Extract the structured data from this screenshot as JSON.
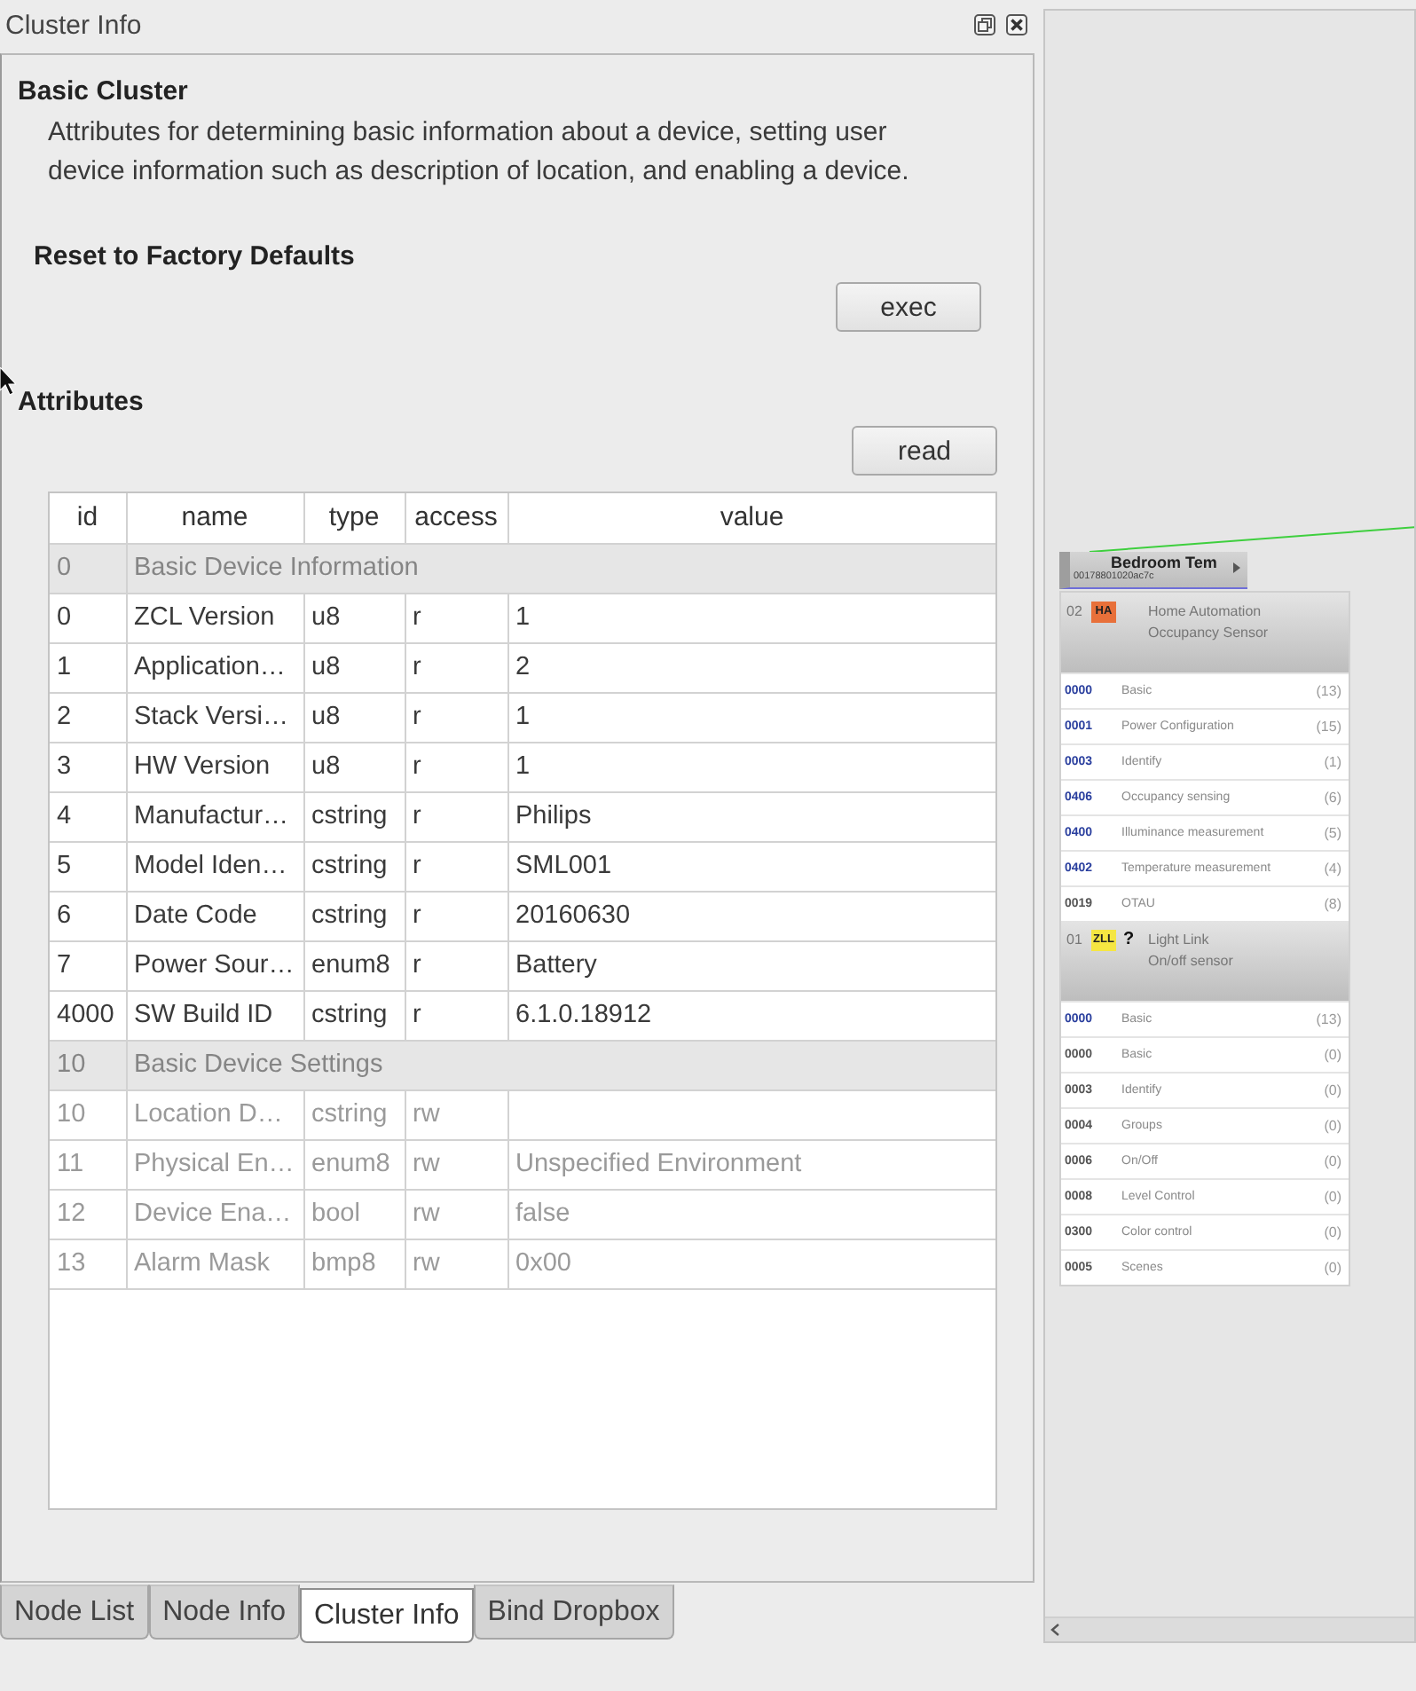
{
  "window": {
    "title": "Cluster Info"
  },
  "cluster": {
    "title": "Basic Cluster",
    "description": "Attributes for determining basic information about a device, setting user device information such as description of location, and enabling a device.",
    "commands": [
      {
        "title": "Reset to Factory Defaults",
        "button": "exec"
      }
    ],
    "attributes": {
      "title": "Attributes",
      "button": "read"
    }
  },
  "table": {
    "columns": [
      "id",
      "name",
      "type",
      "access",
      "value"
    ],
    "rows": [
      {
        "kind": "group",
        "id": "0",
        "name": "Basic Device Information"
      },
      {
        "kind": "attribute",
        "id": "0",
        "name": "ZCL Version",
        "type": "u8",
        "access": "r",
        "value": "1",
        "disabled": false
      },
      {
        "kind": "attribute",
        "id": "1",
        "name": "Application…",
        "type": "u8",
        "access": "r",
        "value": "2",
        "disabled": false
      },
      {
        "kind": "attribute",
        "id": "2",
        "name": "Stack Versi…",
        "type": "u8",
        "access": "r",
        "value": "1",
        "disabled": false
      },
      {
        "kind": "attribute",
        "id": "3",
        "name": "HW Version",
        "type": "u8",
        "access": "r",
        "value": "1",
        "disabled": false
      },
      {
        "kind": "attribute",
        "id": "4",
        "name": "Manufactur…",
        "type": "cstring",
        "access": "r",
        "value": "Philips",
        "disabled": false
      },
      {
        "kind": "attribute",
        "id": "5",
        "name": "Model Iden…",
        "type": "cstring",
        "access": "r",
        "value": "SML001",
        "disabled": false
      },
      {
        "kind": "attribute",
        "id": "6",
        "name": "Date Code",
        "type": "cstring",
        "access": "r",
        "value": "20160630",
        "disabled": false
      },
      {
        "kind": "attribute",
        "id": "7",
        "name": "Power Sour…",
        "type": "enum8",
        "access": "r",
        "value": "Battery",
        "disabled": false
      },
      {
        "kind": "attribute",
        "id": "4000",
        "name": "SW Build ID",
        "type": "cstring",
        "access": "r",
        "value": "6.1.0.18912",
        "disabled": false
      },
      {
        "kind": "group",
        "id": "10",
        "name": "Basic Device Settings"
      },
      {
        "kind": "attribute",
        "id": "10",
        "name": "Location D…",
        "type": "cstring",
        "access": "rw",
        "disabled": true
      },
      {
        "kind": "attribute",
        "id": "11",
        "name": "Physical En…",
        "type": "enum8",
        "access": "rw",
        "value": "Unspecified Environment",
        "disabled": true
      },
      {
        "kind": "attribute",
        "id": "12",
        "name": "Device Ena…",
        "type": "bool",
        "access": "rw",
        "value": "false",
        "disabled": true
      },
      {
        "kind": "attribute",
        "id": "13",
        "name": "Alarm Mask",
        "type": "bmp8",
        "access": "rw",
        "value": "0x00",
        "disabled": true
      }
    ]
  },
  "tabs": [
    {
      "label": "Node List",
      "selected": false
    },
    {
      "label": "Node Info",
      "selected": false
    },
    {
      "label": "Cluster Info",
      "selected": true
    },
    {
      "label": "Bind Dropbox",
      "selected": false
    }
  ],
  "canvas": {
    "node": {
      "title": "Bedroom Tem",
      "address": "00178801020ac7c",
      "endpoints": [
        {
          "number": "02",
          "profile": "HA",
          "color": "#e8703a",
          "profile_name": "Home Automation",
          "device_type": "Occupancy Sensor",
          "clusters": [
            {
              "id": "0000",
              "name": "Basic",
              "count": "(13)",
              "color": "#2a3f9e"
            },
            {
              "id": "0001",
              "name": "Power Configuration",
              "count": "(15)",
              "color": "#2a3f9e"
            },
            {
              "id": "0003",
              "name": "Identify",
              "count": "(1)",
              "color": "#2a3f9e"
            },
            {
              "id": "0406",
              "name": "Occupancy sensing",
              "count": "(6)",
              "color": "#2a3f9e"
            },
            {
              "id": "0400",
              "name": "Illuminance measurement",
              "count": "(5)",
              "color": "#2a3f9e"
            },
            {
              "id": "0402",
              "name": "Temperature measurement",
              "count": "(4)",
              "color": "#2a3f9e"
            },
            {
              "id": "0019",
              "name": "OTAU",
              "count": "(8)",
              "color": "#555555"
            }
          ]
        },
        {
          "number": "01",
          "profile": "ZLL",
          "color": "#f5e642",
          "flag": "?",
          "profile_name": "Light Link",
          "device_type": "On/off sensor",
          "clusters": [
            {
              "id": "0000",
              "name": "Basic",
              "count": "(13)",
              "color": "#2a3f9e"
            },
            {
              "id": "0000",
              "name": "Basic",
              "count": "(0)",
              "color": "#555555"
            },
            {
              "id": "0003",
              "name": "Identify",
              "count": "(0)",
              "color": "#555555"
            },
            {
              "id": "0004",
              "name": "Groups",
              "count": "(0)",
              "color": "#555555"
            },
            {
              "id": "0006",
              "name": "On/Off",
              "count": "(0)",
              "color": "#555555"
            },
            {
              "id": "0008",
              "name": "Level Control",
              "count": "(0)",
              "color": "#555555"
            },
            {
              "id": "0300",
              "name": "Color control",
              "count": "(0)",
              "color": "#555555"
            },
            {
              "id": "0005",
              "name": "Scenes",
              "count": "(0)",
              "color": "#555555"
            }
          ]
        }
      ]
    }
  }
}
